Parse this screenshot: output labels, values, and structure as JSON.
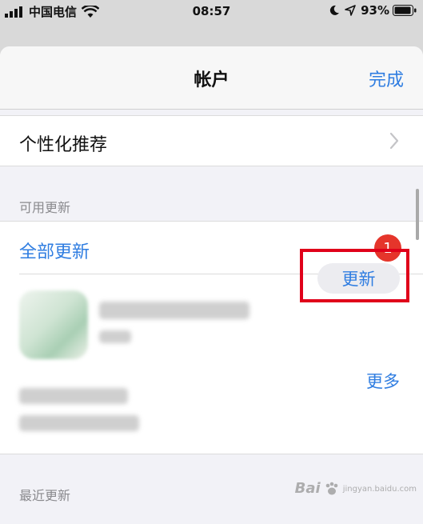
{
  "status_bar": {
    "carrier": "中国电信",
    "time": "08:57",
    "battery": "93%"
  },
  "nav": {
    "title": "帐户",
    "done_label": "完成"
  },
  "personalized": {
    "label": "个性化推荐"
  },
  "sections": {
    "available_updates": "可用更新",
    "recent_updates": "最近更新"
  },
  "updates": {
    "update_all_label": "全部更新",
    "badge_count": "1",
    "update_button_label": "更新",
    "more_label": "更多"
  },
  "watermark": {
    "text": "Bai",
    "sub": "jingyan.baidu.com"
  },
  "colors": {
    "accent": "#2f7de1",
    "badge": "#e5352b",
    "highlight_frame": "#e0001a"
  }
}
